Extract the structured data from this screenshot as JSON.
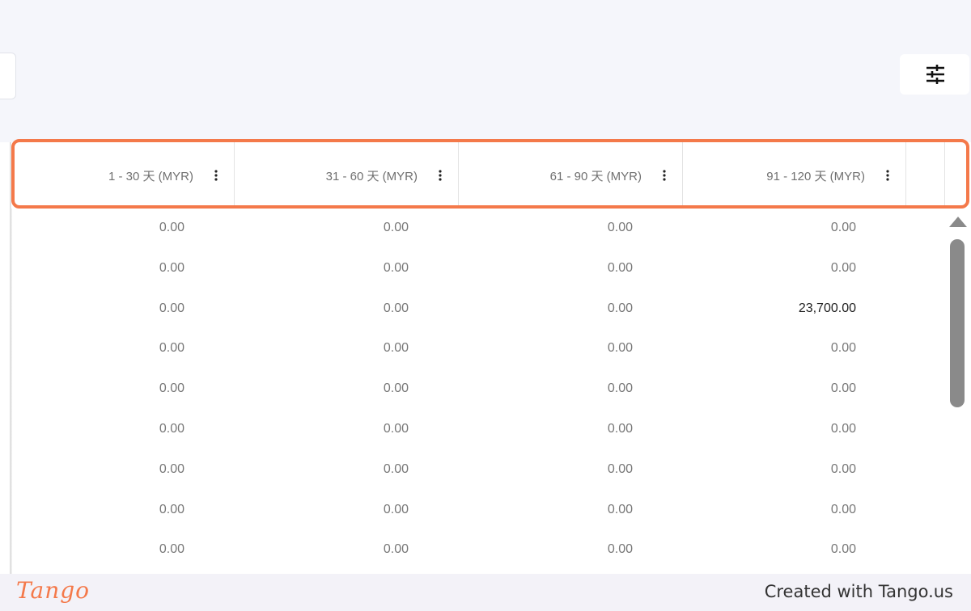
{
  "toolbar": {
    "filter_icon": "sliders-icon"
  },
  "columns": [
    {
      "label": "1 - 30 天 (MYR)"
    },
    {
      "label": "31 - 60 天 (MYR)"
    },
    {
      "label": "61 - 90 天 (MYR)"
    },
    {
      "label": "91 - 120 天 (MYR)"
    }
  ],
  "rows": [
    [
      "0.00",
      "0.00",
      "0.00",
      "0.00"
    ],
    [
      "0.00",
      "0.00",
      "0.00",
      "0.00"
    ],
    [
      "0.00",
      "0.00",
      "0.00",
      "23,700.00"
    ],
    [
      "0.00",
      "0.00",
      "0.00",
      "0.00"
    ],
    [
      "0.00",
      "0.00",
      "0.00",
      "0.00"
    ],
    [
      "0.00",
      "0.00",
      "0.00",
      "0.00"
    ],
    [
      "0.00",
      "0.00",
      "0.00",
      "0.00"
    ],
    [
      "0.00",
      "0.00",
      "0.00",
      "0.00"
    ],
    [
      "0.00",
      "0.00",
      "0.00",
      "0.00"
    ]
  ],
  "footer": {
    "logo_text": "Tango",
    "credit": "Created with Tango.us"
  },
  "colors": {
    "highlight": "#f4794a",
    "background": "#f5f6fb"
  }
}
